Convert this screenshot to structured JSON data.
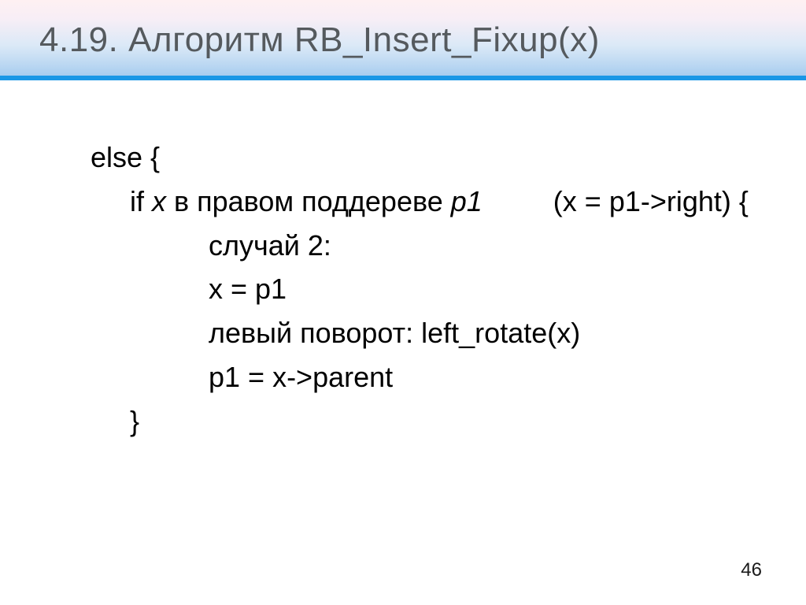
{
  "header": {
    "title": "4.19. Алгоритм RB_Insert_Fixup(x)"
  },
  "body": {
    "line1": "else {",
    "line2_pre": "if ",
    "line2_x": "x",
    "line2_mid": " в правом поддереве ",
    "line2_p1": "p1",
    "line2_post": "         (x = p1->right) {",
    "line3": "случай 2:",
    "line4": "x = p1",
    "line5": "левый поворот: left_rotate(x)",
    "line6": "p1 = x->parent",
    "line7": "}"
  },
  "page": {
    "number": "46"
  }
}
